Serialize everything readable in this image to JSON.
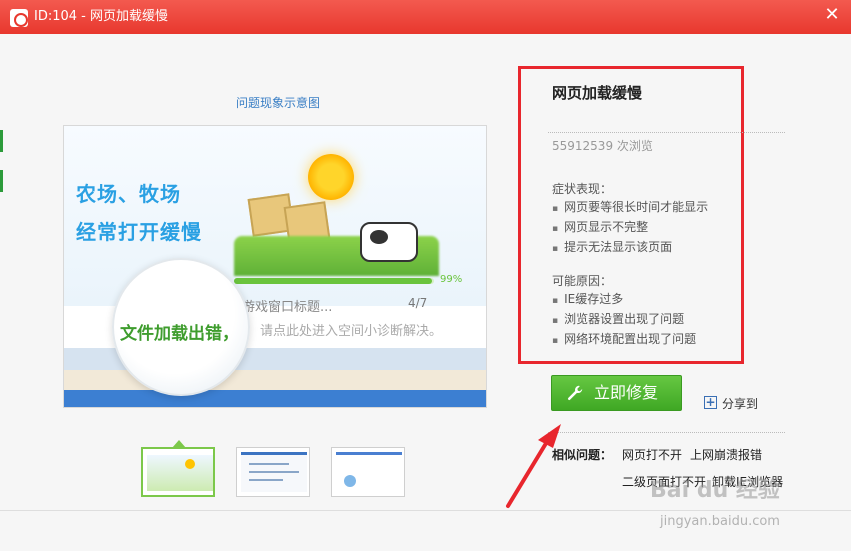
{
  "window": {
    "title": "ID:104 - 网页加载缓慢",
    "close_icon": "close-icon"
  },
  "image_panel": {
    "caption": "问题现象示意图",
    "headline_line1": "农场、牧场",
    "headline_line2": "经常打开缓慢",
    "progress_percent": "99%",
    "progress_value": 0.99,
    "window_title": "游戏窗口标题...",
    "count": "4/7",
    "magnifier_text": "文件加载出错，",
    "status_rest": "请点此处进入空间小诊断解决。"
  },
  "info": {
    "title": "网页加载缓慢",
    "views": "55912539 次浏览",
    "symptoms_label": "症状表现：",
    "symptoms": [
      "网页要等很长时间才能显示",
      "网页显示不完整",
      "提示无法显示该页面"
    ],
    "causes_label": "可能原因：",
    "causes": [
      "IE缓存过多",
      "浏览器设置出现了问题",
      "网络环境配置出现了问题"
    ]
  },
  "actions": {
    "fix_label": "立即修复",
    "share_label": "分享到"
  },
  "related": {
    "label": "相似问题：",
    "links": [
      "网页打不开",
      "上网崩溃报错",
      "二级页面打不开",
      "卸载IE浏览器"
    ]
  },
  "watermark": {
    "main": "Bai du 经验",
    "sub": "jingyan.baidu.com"
  },
  "colors": {
    "titlebar": "#e8382e",
    "highlight_box": "#e8262d",
    "fix_button": "#4db42e",
    "link_blue": "#3a7fc5"
  }
}
